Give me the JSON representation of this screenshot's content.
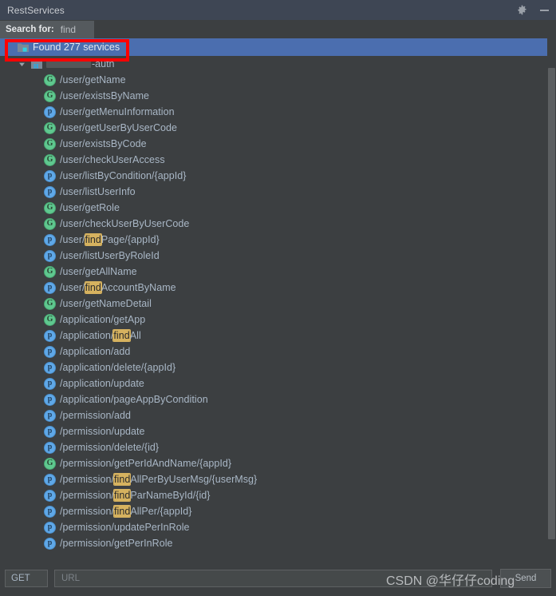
{
  "window": {
    "title": "RestServices",
    "gear_icon": "gear-icon",
    "minimize_icon": "minimize-icon"
  },
  "search": {
    "label": "Search for:",
    "value": "find",
    "placeholder": "find"
  },
  "tree": {
    "root": {
      "label": "Found 277 services",
      "icon": "module-folder-icon",
      "expanded": true,
      "selected": true
    },
    "module": {
      "label_redacted": true,
      "label_suffix": "-auth",
      "icon": "module-icon",
      "expanded": true
    },
    "endpoints": [
      {
        "method": "G",
        "path": "/user/getName",
        "highlight": ""
      },
      {
        "method": "G",
        "path": "/user/existsByName",
        "highlight": ""
      },
      {
        "method": "P",
        "path": "/user/getMenuInformation",
        "highlight": ""
      },
      {
        "method": "G",
        "path": "/user/getUserByUserCode",
        "highlight": ""
      },
      {
        "method": "G",
        "path": "/user/existsByCode",
        "highlight": ""
      },
      {
        "method": "G",
        "path": "/user/checkUserAccess",
        "highlight": ""
      },
      {
        "method": "P",
        "path": "/user/listByCondition/{appId}",
        "highlight": ""
      },
      {
        "method": "P",
        "path": "/user/listUserInfo",
        "highlight": ""
      },
      {
        "method": "G",
        "path": "/user/getRole",
        "highlight": ""
      },
      {
        "method": "G",
        "path": "/user/checkUserByUserCode",
        "highlight": ""
      },
      {
        "method": "P",
        "path": "/user/findPage/{appId}",
        "highlight": "find"
      },
      {
        "method": "P",
        "path": "/user/listUserByRoleId",
        "highlight": ""
      },
      {
        "method": "G",
        "path": "/user/getAllName",
        "highlight": ""
      },
      {
        "method": "P",
        "path": "/user/findAccountByName",
        "highlight": "find"
      },
      {
        "method": "G",
        "path": "/user/getNameDetail",
        "highlight": ""
      },
      {
        "method": "G",
        "path": "/application/getApp",
        "highlight": ""
      },
      {
        "method": "P",
        "path": "/application/findAll",
        "highlight": "find"
      },
      {
        "method": "P",
        "path": "/application/add",
        "highlight": ""
      },
      {
        "method": "P",
        "path": "/application/delete/{appId}",
        "highlight": ""
      },
      {
        "method": "P",
        "path": "/application/update",
        "highlight": ""
      },
      {
        "method": "P",
        "path": "/application/pageAppByCondition",
        "highlight": ""
      },
      {
        "method": "P",
        "path": "/permission/add",
        "highlight": ""
      },
      {
        "method": "P",
        "path": "/permission/update",
        "highlight": ""
      },
      {
        "method": "P",
        "path": "/permission/delete/{id}",
        "highlight": ""
      },
      {
        "method": "G",
        "path": "/permission/getPerIdAndName/{appId}",
        "highlight": ""
      },
      {
        "method": "P",
        "path": "/permission/findAllPerByUserMsg/{userMsg}",
        "highlight": "find"
      },
      {
        "method": "P",
        "path": "/permission/findParNameById/{id}",
        "highlight": "find"
      },
      {
        "method": "P",
        "path": "/permission/findAllPer/{appId}",
        "highlight": "find"
      },
      {
        "method": "P",
        "path": "/permission/updatePerInRole",
        "highlight": ""
      },
      {
        "method": "P",
        "path": "/permission/getPerInRole",
        "highlight": ""
      }
    ]
  },
  "bottom": {
    "method": "GET",
    "url_placeholder": "URL",
    "url_value": "",
    "send_label": "Send"
  },
  "watermark": {
    "text": "CSDN @华仔仔coding"
  },
  "colors": {
    "background": "#3c3f41",
    "titlebar": "#3e4654",
    "selection": "#4b6eaf",
    "get_badge": "#5fc88f",
    "post_badge": "#5fa8e8",
    "highlight": "#d6b25f",
    "annotation": "#fe0000"
  }
}
